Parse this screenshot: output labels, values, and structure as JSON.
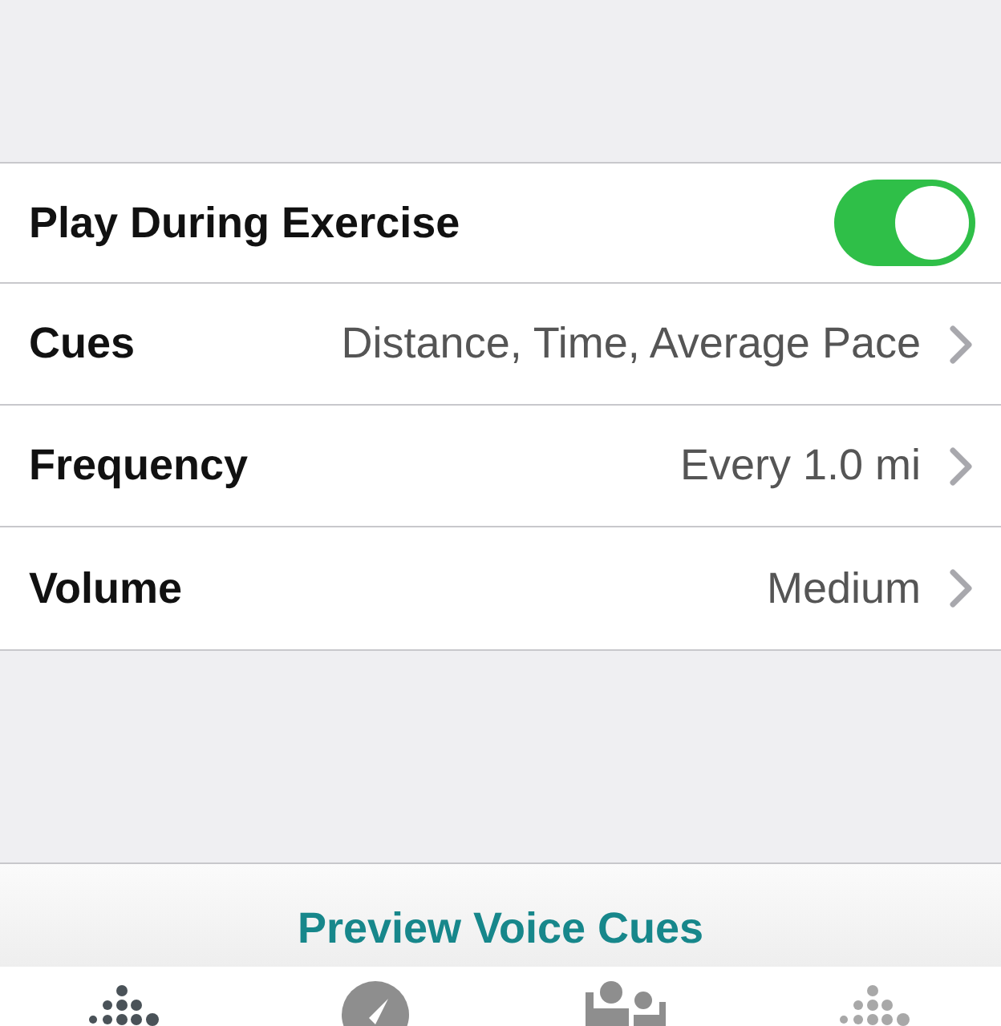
{
  "settings": [
    {
      "kind": "toggle",
      "label": "Play During Exercise",
      "on": true
    },
    {
      "kind": "link",
      "label": "Cues",
      "value": "Distance, Time, Average Pace"
    },
    {
      "kind": "link",
      "label": "Frequency",
      "value": "Every 1.0 mi"
    },
    {
      "kind": "link",
      "label": "Volume",
      "value": "Medium"
    }
  ],
  "preview_button": "Preview Voice Cues",
  "tabs": [
    {
      "kind": "dots",
      "selected": true
    },
    {
      "kind": "compass",
      "selected": false
    },
    {
      "kind": "people",
      "selected": false
    },
    {
      "kind": "dots",
      "selected": false
    }
  ]
}
